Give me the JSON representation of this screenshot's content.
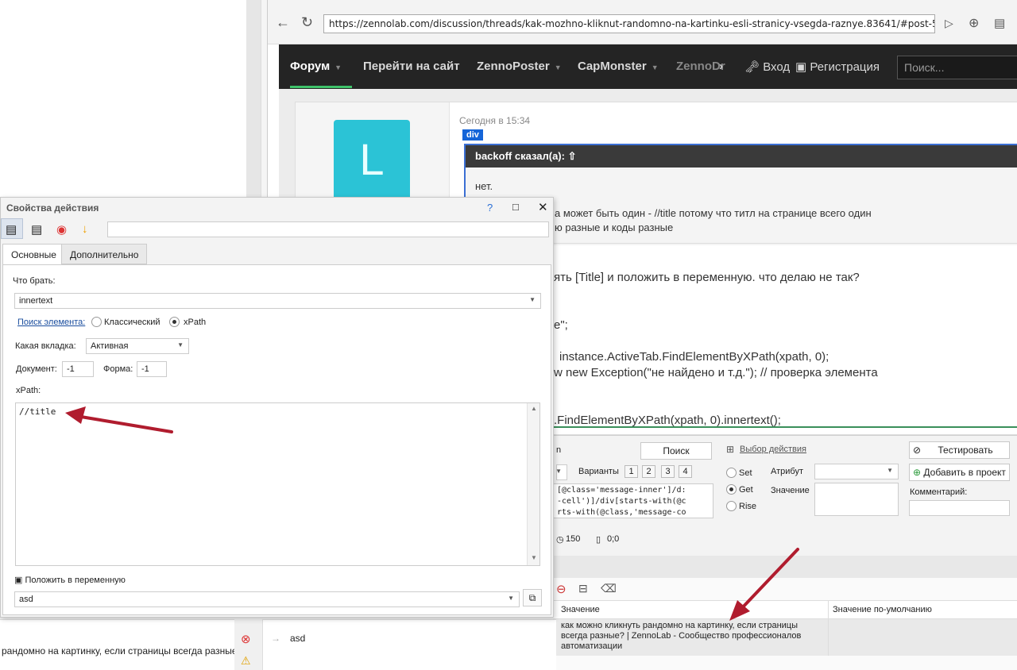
{
  "browser": {
    "url": "https://zennolab.com/discussion/threads/kak-mozhno-kliknut-randomno-na-kartinku-esli-stranicy-vsegda-raznye.83641/#post-56217",
    "nav": {
      "forum": "Форум",
      "site": "Перейти на сайт",
      "zennoposter": "ZennoPoster",
      "capmonster": "CapMonster",
      "zennodroid": "ZennoDr",
      "login": "Вход",
      "register": "Регистрация",
      "search_placeholder": "Поиск..."
    },
    "post": {
      "avatar_letter": "L",
      "date": "Сегодня в 15:34",
      "tag": "div",
      "quote_author": "backoff сказал(а):",
      "quote_line1": "нет.",
      "quote_line2": "а может быть один - //title потому что титл на странице всего один",
      "quote_line3": "ю разные и коды разные",
      "body_line1": "ять [Title] и положить в переменную. что делаю не так?",
      "body_line2": "e\";",
      "body_line3": "instance.ActiveTab.FindElementByXPath(xpath, 0);",
      "body_line4": "w new Exception(\"не найдено и т.д.\"); // проверка элемента",
      "body_line5": ".FindElementByXPath(xpath, 0).innertext();"
    }
  },
  "action_panel": {
    "label_fragment": "n",
    "search_button": "Поиск",
    "choose_action": "Выбор действия",
    "test_button": "Тестировать",
    "add_button": "Добавить в проект",
    "variants_label": "Варианты",
    "variants": [
      "1",
      "2",
      "3",
      "4"
    ],
    "attribute_label": "Атрибут",
    "value_label": "Значение",
    "comment_label": "Комментарий:",
    "radio_set": "Set",
    "radio_get": "Get",
    "radio_rise": "Rise",
    "code_line1": "[@class='message-inner']/d:",
    "code_line2": "-cell')]/div[starts-with(@c",
    "code_line3": "rts-with(@class,'message-co",
    "timer_value": "150",
    "coords_value": "0;0"
  },
  "vars_panel": {
    "col_value": "Значение",
    "col_default": "Значение по-умолчанию",
    "row_name": "asd",
    "row_value": "как можно кликнуть рандомно на картинку, если страницы всегда разные? | ZennoLab - Сообщество профессионалов автоматизации"
  },
  "bottom_left": {
    "text": "рандомно на картинку, если страницы всегда разные? |"
  },
  "dialog": {
    "title": "Свойства действия",
    "help": "?",
    "tabs": [
      "Основные",
      "Дополнительно"
    ],
    "what_to_take_label": "Что брать:",
    "what_to_take_value": "innertext",
    "search_label": "Поиск элемента:",
    "radio_classic": "Классический",
    "radio_xpath": "xPath",
    "tab_label": "Какая вкладка:",
    "tab_value": "Активная",
    "document_label": "Документ:",
    "document_value": "-1",
    "form_label": "Форма:",
    "form_value": "-1",
    "xpath_label": "xPath:",
    "xpath_value": "//title",
    "save_var_label": "Положить в переменную",
    "variable_value": "asd"
  },
  "colors": {
    "nav_bg": "#242424",
    "nav_accent": "#3fc36a",
    "avatar": "#2bc3d6",
    "tag_blue": "#1565d8",
    "arrow_red": "#b01c2e"
  }
}
